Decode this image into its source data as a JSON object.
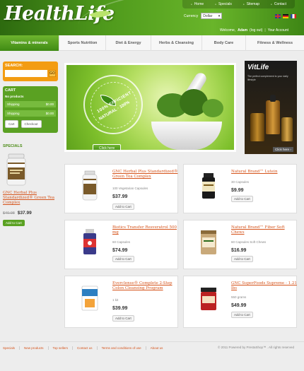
{
  "logo": {
    "text": "HealthLife"
  },
  "topnav": [
    "Home",
    "Specials",
    "Sitemap",
    "Contact"
  ],
  "currency": {
    "label": "Currency",
    "selected": "Dollar"
  },
  "welcome": {
    "prefix": "Welcome,",
    "user": "Adam",
    "logout": "(log out)",
    "account": "Your Account"
  },
  "nav": [
    "Vitamins & minerals",
    "Sports Nutrition",
    "Diet & Energy",
    "Herbs & Cleansing",
    "Body Care",
    "Fitness & Wellness"
  ],
  "search": {
    "label": "SEARCH:",
    "placeholder": "",
    "button": "GO"
  },
  "cart": {
    "title": "CART",
    "empty": "No products",
    "shipping_label": "Shipping",
    "shipping_value": "$0.00",
    "total_label": "Shipping",
    "total_value": "$0.00",
    "cart_button": "Cart",
    "checkout_button": "Checkout"
  },
  "specials": {
    "heading": "SPECIALS",
    "name": "GNC Herbal Plus Standardized® Green Tea Complex",
    "old_price": "$40.98",
    "new_price": "$37.99",
    "add": "Add to Cart"
  },
  "banner": {
    "seal_top": "100% EFFICIENT",
    "seal_bottom": "NATURAL · 100%",
    "button": "Click here"
  },
  "ad": {
    "brand": "VitLife",
    "tagline": "The perfect complement to your daily lifestyle",
    "more": "Click here ›"
  },
  "products": [
    {
      "name": "GNC Herbal Plus Standardized® Green Tea Complex",
      "desc": "100 Vegetarian Capsules",
      "price": "$37.99",
      "add": "Add to Cart"
    },
    {
      "name": "Natural Brand™ Lutein",
      "desc": "30 Capsules",
      "price": "$9.99",
      "add": "Add to Cart"
    },
    {
      "name": "Biotics Transfer Resveratrol 500 mg",
      "desc": "60 Capsules",
      "price": "$74.99",
      "add": "Add to Cart"
    },
    {
      "name": "Natural Brand™ Fiber Soft Chews",
      "desc": "60 Capsules Soft Chews",
      "price": "$16.99",
      "add": "Add to Cart"
    },
    {
      "name": "Everclense® Complete 2-Step Colon Cleansing Program",
      "desc": "1 kit",
      "price": "$39.99",
      "add": "Add to Cart"
    },
    {
      "name": "GNC SuperFoods Supreme - 1.21 lbs",
      "desc": "550 grams",
      "price": "$49.99",
      "add": "Add to Cart"
    }
  ],
  "footer": {
    "links": [
      "Specials",
      "New products",
      "Top sellers",
      "Contact us",
      "Terms and conditions of use",
      "About us"
    ],
    "copyright": "© 2011 Powered by PrestaShop™ . All rights reserved"
  }
}
